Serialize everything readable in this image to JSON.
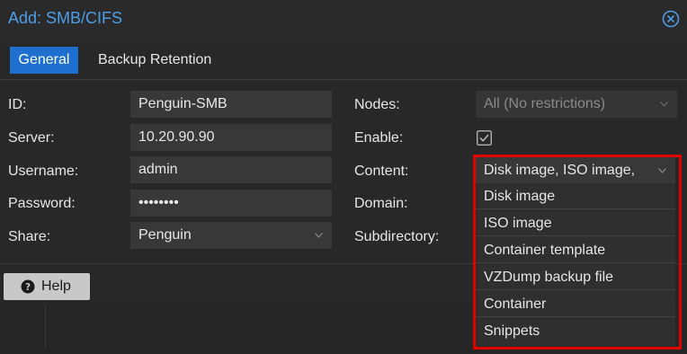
{
  "dialog": {
    "title": "Add: SMB/CIFS",
    "tabs": [
      {
        "label": "General",
        "active": true
      },
      {
        "label": "Backup Retention",
        "active": false
      }
    ]
  },
  "form": {
    "left": [
      {
        "label": "ID:",
        "value": "Penguin-SMB"
      },
      {
        "label": "Server:",
        "value": "10.20.90.90"
      },
      {
        "label": "Username:",
        "value": "admin"
      },
      {
        "label": "Password:",
        "value": "••••••••"
      },
      {
        "label": "Share:",
        "value": "Penguin"
      }
    ],
    "right": [
      {
        "label": "Nodes:",
        "value": "All (No restrictions)"
      },
      {
        "label": "Enable:",
        "checked": true
      },
      {
        "label": "Content:",
        "value": "Disk image, ISO image,"
      },
      {
        "label": "Domain:"
      },
      {
        "label": "Subdirectory:"
      }
    ]
  },
  "content_dropdown": {
    "options": [
      "Disk image",
      "ISO image",
      "Container template",
      "VZDump backup file",
      "Container",
      "Snippets"
    ]
  },
  "footer": {
    "help_label": "Help"
  },
  "colors": {
    "accent": "#1e6fcf",
    "title": "#4d9ee6",
    "highlight": "#e00000"
  }
}
